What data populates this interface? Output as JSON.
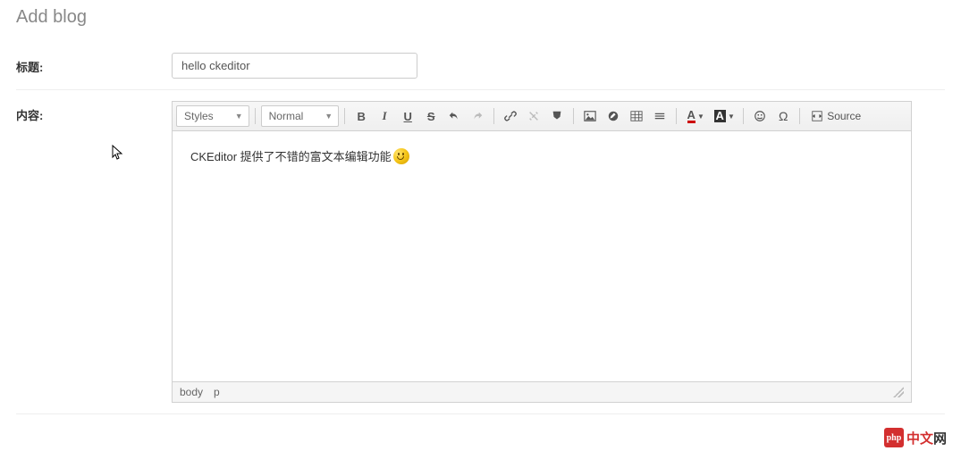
{
  "page": {
    "title": "Add blog"
  },
  "form": {
    "title_label": "标题:",
    "title_value": "hello ckeditor",
    "content_label": "内容:"
  },
  "editor": {
    "toolbar": {
      "styles_label": "Styles",
      "format_label": "Normal",
      "source_label": "Source",
      "buttons": {
        "bold": "bold-icon",
        "italic": "italic-icon",
        "underline": "underline-icon",
        "strike": "strike-icon",
        "undo": "undo-icon",
        "redo": "redo-icon",
        "link": "link-icon",
        "unlink": "unlink-icon",
        "anchor": "anchor-icon",
        "image": "image-icon",
        "format_paint": "format-paint-icon",
        "table": "table-icon",
        "hr": "hr-icon",
        "textcolor": "text-color-icon",
        "bgcolor": "bg-color-icon",
        "smiley": "smiley-icon",
        "omega": "specialchar-icon",
        "source": "source-icon"
      }
    },
    "content_text": "CKEditor 提供了不错的富文本编辑功能",
    "path": {
      "body": "body",
      "p": "p"
    }
  },
  "branding": {
    "icon": "php",
    "part1": "中文",
    "part2": "网"
  }
}
